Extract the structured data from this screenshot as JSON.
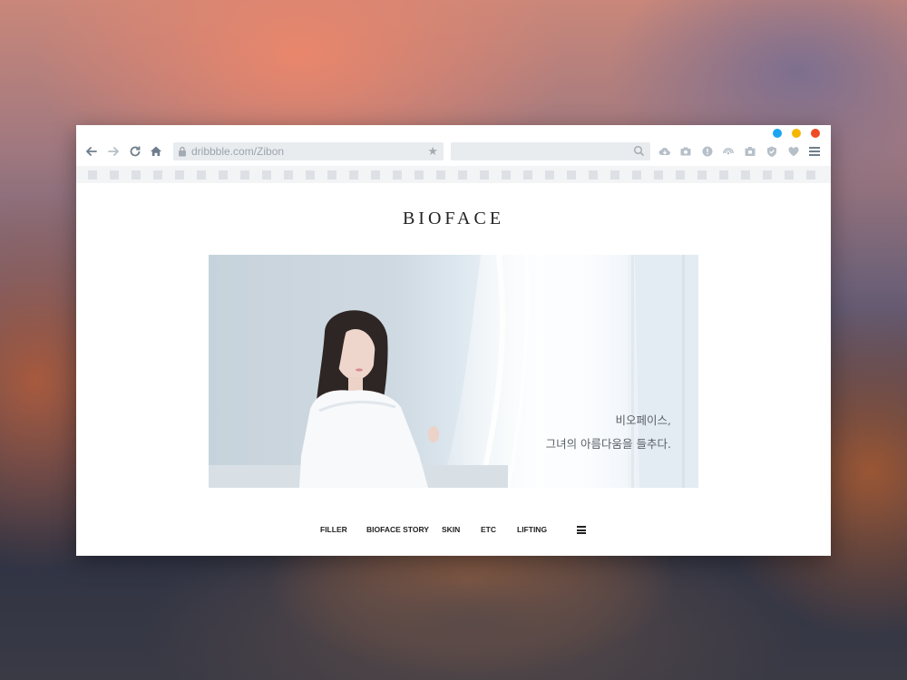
{
  "colors": {
    "traffic_blue": "#1aa6f1",
    "traffic_yellow": "#f6b500",
    "traffic_red": "#ef4b24",
    "toolbar_icon": "#6f7e8c",
    "toolbar_icon_light": "#b7c0c8"
  },
  "browser": {
    "url": "dribbble.com/Zibon",
    "icons": [
      "back-arrow-icon",
      "forward-arrow-icon",
      "reload-icon",
      "home-icon",
      "lock-icon",
      "star-icon",
      "search-icon",
      "cloud-download-icon",
      "camera-icon",
      "info-icon",
      "rss-icon",
      "screenshot-icon",
      "shield-check-icon",
      "heart-icon",
      "menu-icon"
    ]
  },
  "site": {
    "logo": "BIOFACE",
    "hero": {
      "line1": "비오페이스,",
      "line2": "그녀의 아름다움을 들추다."
    },
    "nav": [
      {
        "label": "FILLER"
      },
      {
        "label": "BIOFACE STORY"
      },
      {
        "label": "SKIN"
      },
      {
        "label": "ETC"
      },
      {
        "label": "LIFTING"
      }
    ]
  }
}
